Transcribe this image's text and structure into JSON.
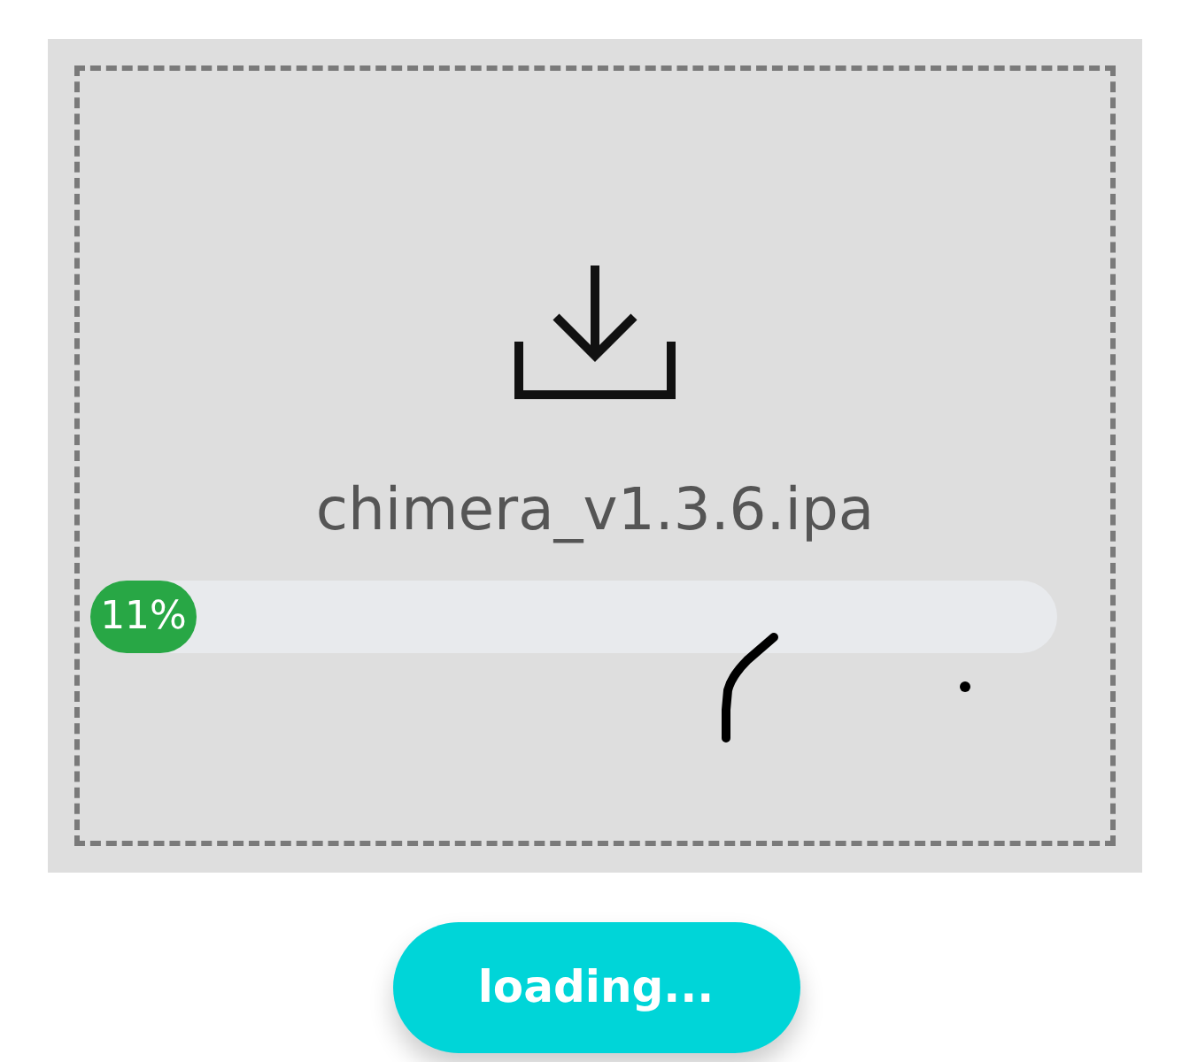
{
  "file": {
    "name": "chimera_v1.3.6.ipa"
  },
  "progress": {
    "level": 0.11,
    "reading": "11%"
  },
  "button": {
    "label": "loading..."
  }
}
